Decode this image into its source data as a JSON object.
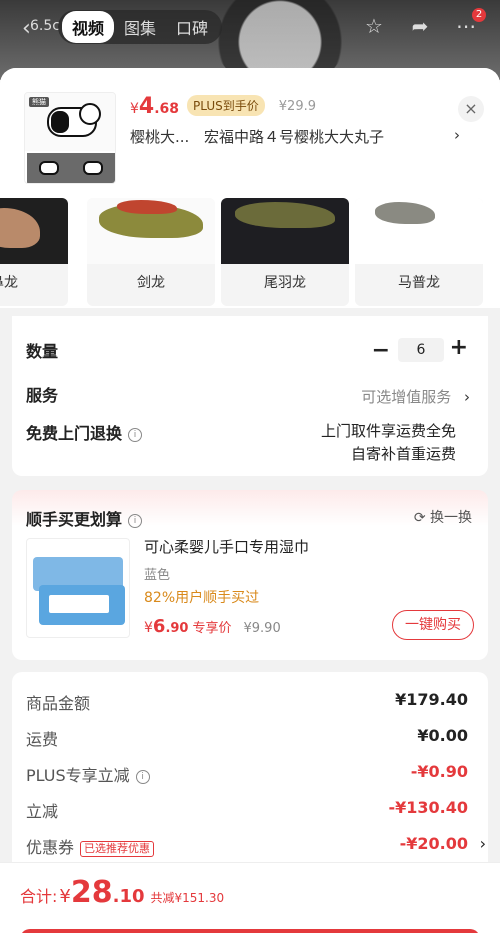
{
  "topbar": {
    "back_text": "6.5c",
    "tabs": [
      {
        "label": "视频",
        "active": true
      },
      {
        "label": "图集",
        "active": false
      },
      {
        "label": "口碑",
        "active": false
      }
    ],
    "icons": [
      "star-icon",
      "share-icon",
      "more-icon"
    ],
    "message_badge": "2"
  },
  "product": {
    "thumb_tag": "熊猫",
    "price_symbol": "¥",
    "price_int": "4",
    "price_dec": ".68",
    "plus_tag": "PLUS到手价",
    "original_price": "¥29.9",
    "addr_name": "樱桃大...",
    "addr_detail": "宏福中路４号樱桃大大丸子",
    "addr_chevron": "›",
    "close": "×"
  },
  "variants": [
    {
      "label": "鼻龙"
    },
    {
      "label": "剑龙"
    },
    {
      "label": "尾羽龙"
    },
    {
      "label": "马普龙"
    }
  ],
  "options": {
    "qty_label": "数量",
    "qty_minus": "−",
    "qty_value": "6",
    "qty_plus": "+",
    "service_label": "服务",
    "service_value": "可选增值服务",
    "service_chevron": "›",
    "free_return_label": "免费上门退换",
    "info_icon": "i",
    "free_return_line1": "上门取件享运费全免",
    "free_return_line2": "自寄补首重运费"
  },
  "bundle": {
    "title": "顺手买更划算",
    "swap_label": "换一换",
    "swap_icon": "⟳",
    "name": "可心柔婴儿手口专用湿巾",
    "color": "蓝色",
    "percent": "82%用户顺手买过",
    "price_symbol": "¥",
    "price_int": "6",
    "price_dec": ".90",
    "exclusive_label": "专享价",
    "original_price": "¥9.90",
    "buy_label": "一键购买"
  },
  "summary": {
    "goods_label": "商品金额",
    "goods_value": "¥179.40",
    "shipping_label": "运费",
    "shipping_value": "¥0.00",
    "plus_label": "PLUS专享立减",
    "plus_value": "-¥0.90",
    "discount_label": "立减",
    "discount_value": "-¥130.40",
    "coupon_label": "优惠券",
    "coupon_tag": "已选推荐优惠",
    "coupon_value": "-¥20.00",
    "coupon_chevron": "›"
  },
  "footer": {
    "total_label": "合计:",
    "total_symbol": "¥",
    "total_int": "28",
    "total_dec": ".10",
    "saved_label": "共减¥151.30"
  },
  "colors": {
    "accent": "#e4393c",
    "plus_gold": "#f8e4b3",
    "percent_orange": "#d98a1c"
  }
}
